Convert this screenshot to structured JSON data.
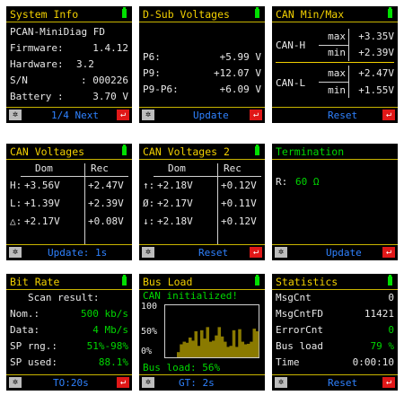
{
  "colors": {
    "title": "#f2d000",
    "accent_blue": "#2f82ff",
    "ok_green": "#00d800",
    "back_red": "#e01818",
    "separator": "#c8b400"
  },
  "icons": {
    "settings": "gear-icon",
    "back": "return-arrow-icon",
    "battery": "battery-icon"
  },
  "sysinfo": {
    "title": "System Info",
    "device": "PCAN-MiniDiag FD",
    "rows": [
      {
        "label": "Firmware:",
        "value": "1.4.12"
      },
      {
        "label": "Hardware:",
        "value": "3.2"
      },
      {
        "label": "S/N",
        "value": ": 000226"
      },
      {
        "label": "Battery :",
        "value": "3.70 V"
      }
    ],
    "footer": "1/4 Next"
  },
  "dsub": {
    "title": "D-Sub Voltages",
    "rows": [
      {
        "label": "P6:",
        "value": "+5.99 V"
      },
      {
        "label": "P9:",
        "value": "+12.07 V"
      },
      {
        "label": "P9-P6:",
        "value": "+6.09 V"
      }
    ],
    "footer": "Update"
  },
  "canminmax": {
    "title": "CAN Min/Max",
    "rows": [
      {
        "signal": "CAN-H",
        "max_label": "max",
        "max": "+3.35V",
        "min_label": "min",
        "min": "+2.39V"
      },
      {
        "signal": "CAN-L",
        "max_label": "max",
        "max": "+2.47V",
        "min_label": "min",
        "min": "+1.55V"
      }
    ],
    "footer": "Reset"
  },
  "canv": {
    "title": "CAN Voltages",
    "col_dom": "Dom",
    "col_rec": "Rec",
    "rows": [
      {
        "label": "H:",
        "dom": "+3.56V",
        "rec": "+2.47V"
      },
      {
        "label": "L:",
        "dom": "+1.39V",
        "rec": "+2.39V"
      },
      {
        "label": "△:",
        "dom": "+2.17V",
        "rec": "+0.08V"
      }
    ],
    "footer": "Update: 1s"
  },
  "canv2": {
    "title": "CAN Voltages 2",
    "col_dom": "Dom",
    "col_rec": "Rec",
    "rows": [
      {
        "label": "↑:",
        "dom": "+2.18V",
        "rec": "+0.12V"
      },
      {
        "label": "Ø:",
        "dom": "+2.17V",
        "rec": "+0.11V"
      },
      {
        "label": "↓:",
        "dom": "+2.18V",
        "rec": "+0.12V"
      }
    ],
    "footer": "Reset"
  },
  "term": {
    "title": "Termination",
    "label": "R:",
    "value": "60 Ω",
    "footer": "Update"
  },
  "bitrate": {
    "title": "Bit Rate",
    "heading": "Scan result:",
    "rows": [
      {
        "label": "Nom.:",
        "value": "500 kb/s"
      },
      {
        "label": "Data:",
        "value": "4 Mb/s"
      },
      {
        "label": "SP rng.:",
        "value": "51%-98%"
      },
      {
        "label": "SP used:",
        "value": "88.1%"
      }
    ],
    "footer": "TO:20s"
  },
  "busload": {
    "title": "Bus Load",
    "status": "CAN initialized!",
    "y_labels": [
      "100",
      "50%",
      "0%"
    ],
    "bars": [
      0,
      0,
      0,
      0,
      10,
      25,
      30,
      28,
      38,
      32,
      50,
      22,
      52,
      36,
      58,
      30,
      32,
      42,
      58,
      40,
      30,
      20,
      22,
      52,
      20,
      54,
      30,
      25,
      26,
      30,
      55,
      50
    ],
    "footer_status": "Bus load: 56%",
    "footer": "GT: 2s"
  },
  "stats": {
    "title": "Statistics",
    "rows": [
      {
        "label": "MsgCnt",
        "value": "0"
      },
      {
        "label": "MsgCntFD",
        "value": "11421"
      },
      {
        "label": "ErrorCnt",
        "value": "0"
      },
      {
        "label": "Bus load",
        "value": "79 %"
      },
      {
        "label": "Time",
        "value": "0:00:10"
      }
    ],
    "footer": "Reset"
  }
}
